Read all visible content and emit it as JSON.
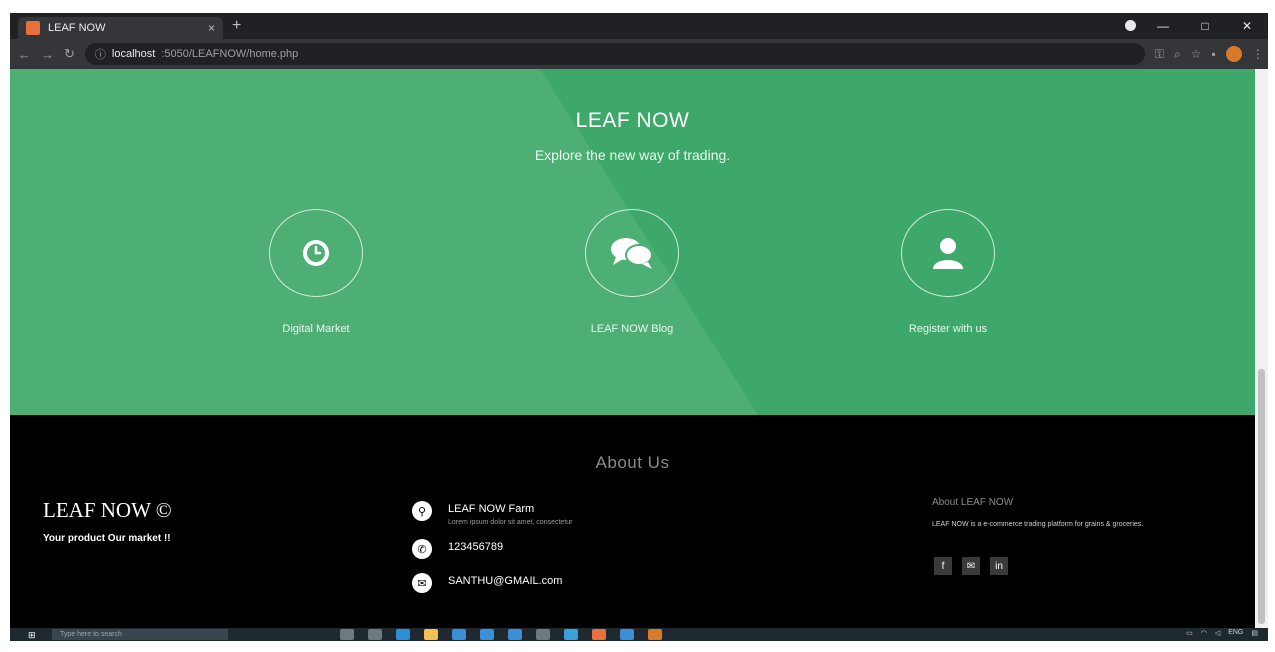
{
  "browser": {
    "tab_title": "LEAF NOW",
    "tab_close": "×",
    "new_tab": "+",
    "url_host": "localhost",
    "url_path": ":5050/LEAFNOW/home.php",
    "window_controls": [
      "—",
      "□",
      "✕"
    ]
  },
  "hero": {
    "title": "LEAF NOW",
    "subtitle": "Explore the new way of trading.",
    "features": [
      {
        "label": "Digital Market",
        "icon": "clock-icon"
      },
      {
        "label": "LEAF NOW Blog",
        "icon": "chat-icon"
      },
      {
        "label": "Register with us",
        "icon": "user-icon"
      }
    ]
  },
  "footer": {
    "heading": "About Us",
    "brand": "LEAF NOW ©",
    "tagline": "Your product Our market !!",
    "contacts": [
      {
        "line1": "LEAF NOW Farm",
        "line2": "Lorem ipsum dolor sit amet, consectetur",
        "icon": "location-icon"
      },
      {
        "line1": "123456789",
        "icon": "phone-icon"
      },
      {
        "line1": "SANTHU@GMAIL.com",
        "icon": "email-icon"
      }
    ],
    "about_title": "About LEAF NOW",
    "about_text": "LEAF NOW is a e-commerce trading platform for grains & groceries.",
    "socials": [
      "f",
      "✉",
      "in"
    ]
  },
  "taskbar": {
    "search_placeholder": "Type here to search",
    "tray_lang": "ENG"
  },
  "colors": {
    "hero_light": "#4daf74",
    "hero_dark": "#3ea86b",
    "footer_bg": "#000000"
  }
}
